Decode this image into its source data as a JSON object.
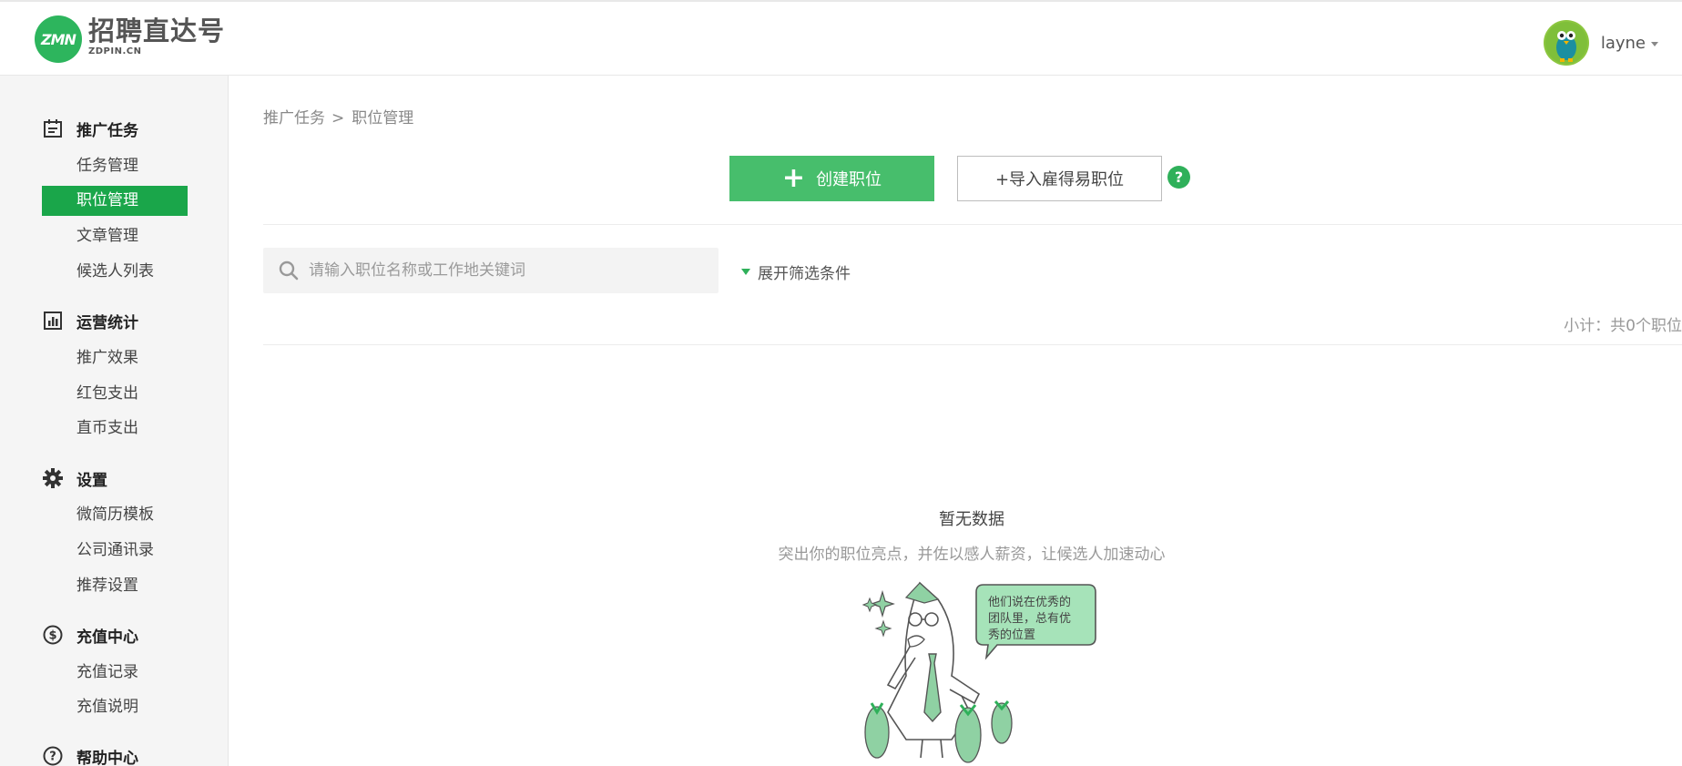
{
  "header": {
    "logo_title": "招聘直达号",
    "logo_sub": "ZDPIN.CN",
    "logo_mark": "ZMN",
    "username": "layne"
  },
  "sidebar": {
    "groups": [
      {
        "title": "推广任务",
        "icon": "calendar-icon",
        "items": [
          {
            "label": "任务管理"
          },
          {
            "label": "职位管理",
            "active": true
          },
          {
            "label": "文章管理"
          },
          {
            "label": "候选人列表"
          }
        ]
      },
      {
        "title": "运营统计",
        "icon": "bar-chart-icon",
        "items": [
          {
            "label": "推广效果"
          },
          {
            "label": "红包支出"
          },
          {
            "label": "直币支出"
          }
        ]
      },
      {
        "title": "设置",
        "icon": "gear-icon",
        "items": [
          {
            "label": "微简历模板"
          },
          {
            "label": "公司通讯录"
          },
          {
            "label": "推荐设置"
          }
        ]
      },
      {
        "title": "充值中心",
        "icon": "dollar-circle-icon",
        "items": [
          {
            "label": "充值记录"
          },
          {
            "label": "充值说明"
          }
        ]
      },
      {
        "title": "帮助中心",
        "icon": "question-circle-icon",
        "items": []
      }
    ]
  },
  "main": {
    "breadcrumb": {
      "parent": "推广任务",
      "separator": ">",
      "current": "职位管理"
    },
    "create_button": "创建职位",
    "import_button": "+导入雇得易职位",
    "help_icon": "?",
    "search_placeholder": "请输入职位名称或工作地关键词",
    "filter_toggle": "展开筛选条件",
    "summary": "小计：共0个职位",
    "empty_title": "暂无数据",
    "empty_desc": "突出你的职位亮点，并佐以感人薪资，让候选人加速动心",
    "bubble_lines": [
      "他们说在优秀的",
      "团队里，总有优",
      "秀的位置"
    ]
  },
  "colors": {
    "brand_green": "#1aa64a",
    "button_green": "#47be6c",
    "help_green": "#2fb05a"
  }
}
